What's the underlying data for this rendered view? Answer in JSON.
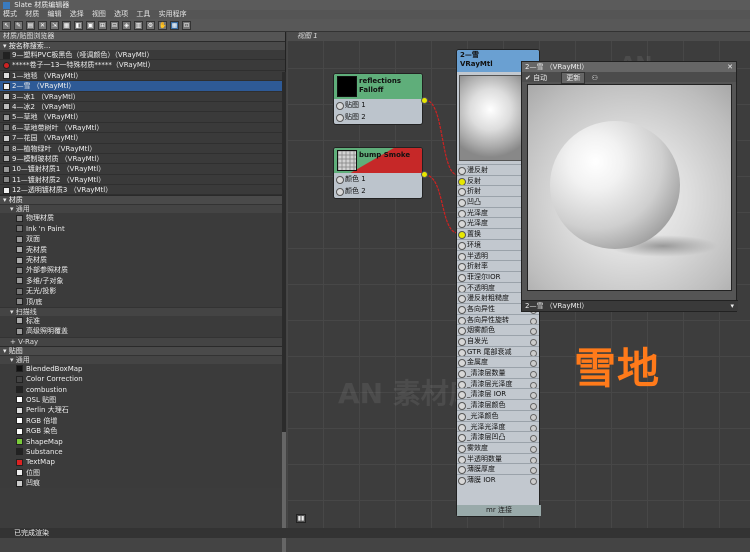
{
  "window": {
    "title": "Slate 材质编辑器"
  },
  "menu": [
    "模式",
    "材质",
    "编辑",
    "选择",
    "视图",
    "选项",
    "工具",
    "实用程序"
  ],
  "browser": {
    "title": "材质/贴图浏览器",
    "search_label": "按名称搜索...",
    "scene_materials": [
      {
        "label": "9—塑料PVC板黑色（哑调颜色）（VRayMtl）",
        "color": "#222222"
      },
      {
        "label": "*****卷子一13一特殊材质*****（VRayMtl）",
        "color": "#cc2222"
      },
      {
        "label": "1—地毯 （VRayMtl）",
        "color": "#dddddd"
      },
      {
        "label": "2—雪 （VRayMtl）",
        "color": "#eeeeee",
        "selected": true
      },
      {
        "label": "3—冰1 （VRayMtl）",
        "color": "#cccccc"
      },
      {
        "label": "4—冰2 （VRayMtl）",
        "color": "#bbbbbb"
      },
      {
        "label": "5—草地 （VRayMtl）",
        "color": "#999999"
      },
      {
        "label": "6—草地带树叶 （VRayMtl）",
        "color": "#777777"
      },
      {
        "label": "7—花园 （VRayMtl）",
        "color": "#cccccc"
      },
      {
        "label": "8—植物绿叶 （VRayMtl）",
        "color": "#888888"
      },
      {
        "label": "9—模制玻材质 （VRayMtl）",
        "color": "#aaaaaa"
      },
      {
        "label": "10—镀射材质1 （VRayMtl）",
        "color": "#999999"
      },
      {
        "label": "11—镀射材质2 （VRayMtl）",
        "color": "#888888"
      },
      {
        "label": "12—透明镀材质3 （VRayMtl）",
        "color": "#eeeeee"
      }
    ],
    "materials_section": "材质",
    "general_label": "通用",
    "materials_general": [
      "物理材质",
      "Ink 'n Paint",
      "双面",
      "壳材质",
      "壳材质",
      "外部参照材质",
      "多维/子对象",
      "无光/投影",
      "顶/底"
    ],
    "scanline_label": "扫描线",
    "scanline": [
      "标准",
      "高级照明覆盖"
    ],
    "vray_label": "+ V-Ray",
    "maps_section": "贴图",
    "maps_general_label": "通用",
    "maps": [
      {
        "label": "BlendedBoxMap",
        "color": "#111111"
      },
      {
        "label": "Color Correction",
        "color": "#444444"
      },
      {
        "label": "combustion",
        "color": "#222222"
      },
      {
        "label": "OSL 贴图",
        "color": "#ffffff"
      },
      {
        "label": "Perlin 大理石",
        "color": "#dddddd"
      },
      {
        "label": "RGB 倍增",
        "color": "#ffffff"
      },
      {
        "label": "RGB 染色",
        "color": "#ffffff"
      },
      {
        "label": "ShapeMap",
        "color": "#7acc3a"
      },
      {
        "label": "Substance",
        "color": "#222222"
      },
      {
        "label": "TextMap",
        "color": "#dd2222"
      },
      {
        "label": "位图",
        "color": "#eeeeee"
      },
      {
        "label": "凹痕",
        "color": "#cccccc"
      }
    ]
  },
  "view": {
    "tab": "视图 1"
  },
  "nodes": {
    "falloff": {
      "title": "reflections Falloff",
      "slots": [
        "贴图 1",
        "贴图 2"
      ]
    },
    "smoke": {
      "title": "bump Smoke",
      "slots": [
        "颜色 1",
        "颜色 2"
      ]
    },
    "vray": {
      "title": "2—雪",
      "subtitle": "VRayMtl",
      "slots": [
        "漫反射",
        "反射",
        "折射",
        "凹凸",
        "光泽度",
        "光泽度",
        "置换",
        "环境",
        "半透明",
        "折射率",
        "菲涅尔IOR",
        "不透明度",
        "漫反射粗糙度",
        "各向异性",
        "各向异性旋转",
        "烟雾颜色",
        "自发光",
        "GTR 尾部衰减",
        "金属度",
        "_清漆层数量",
        "_清漆层光泽度",
        "_清漆层 IOR",
        "_清漆层颜色",
        "_光泽颜色",
        "_光泽光泽度",
        "_清漆层凹凸",
        "雾效度",
        "半透明数量",
        "薄膜厚度",
        "薄膜 IOR"
      ],
      "footer": "mr 连接"
    }
  },
  "preview": {
    "title": "2—雪 （VRayMtl）",
    "auto_label": "自动",
    "update_label": "更新",
    "footer": "2—雪 （VRayMtl）"
  },
  "overlay_text": "雪地",
  "watermark": "AN 素材库",
  "status": {
    "text": "已完成渲染"
  }
}
